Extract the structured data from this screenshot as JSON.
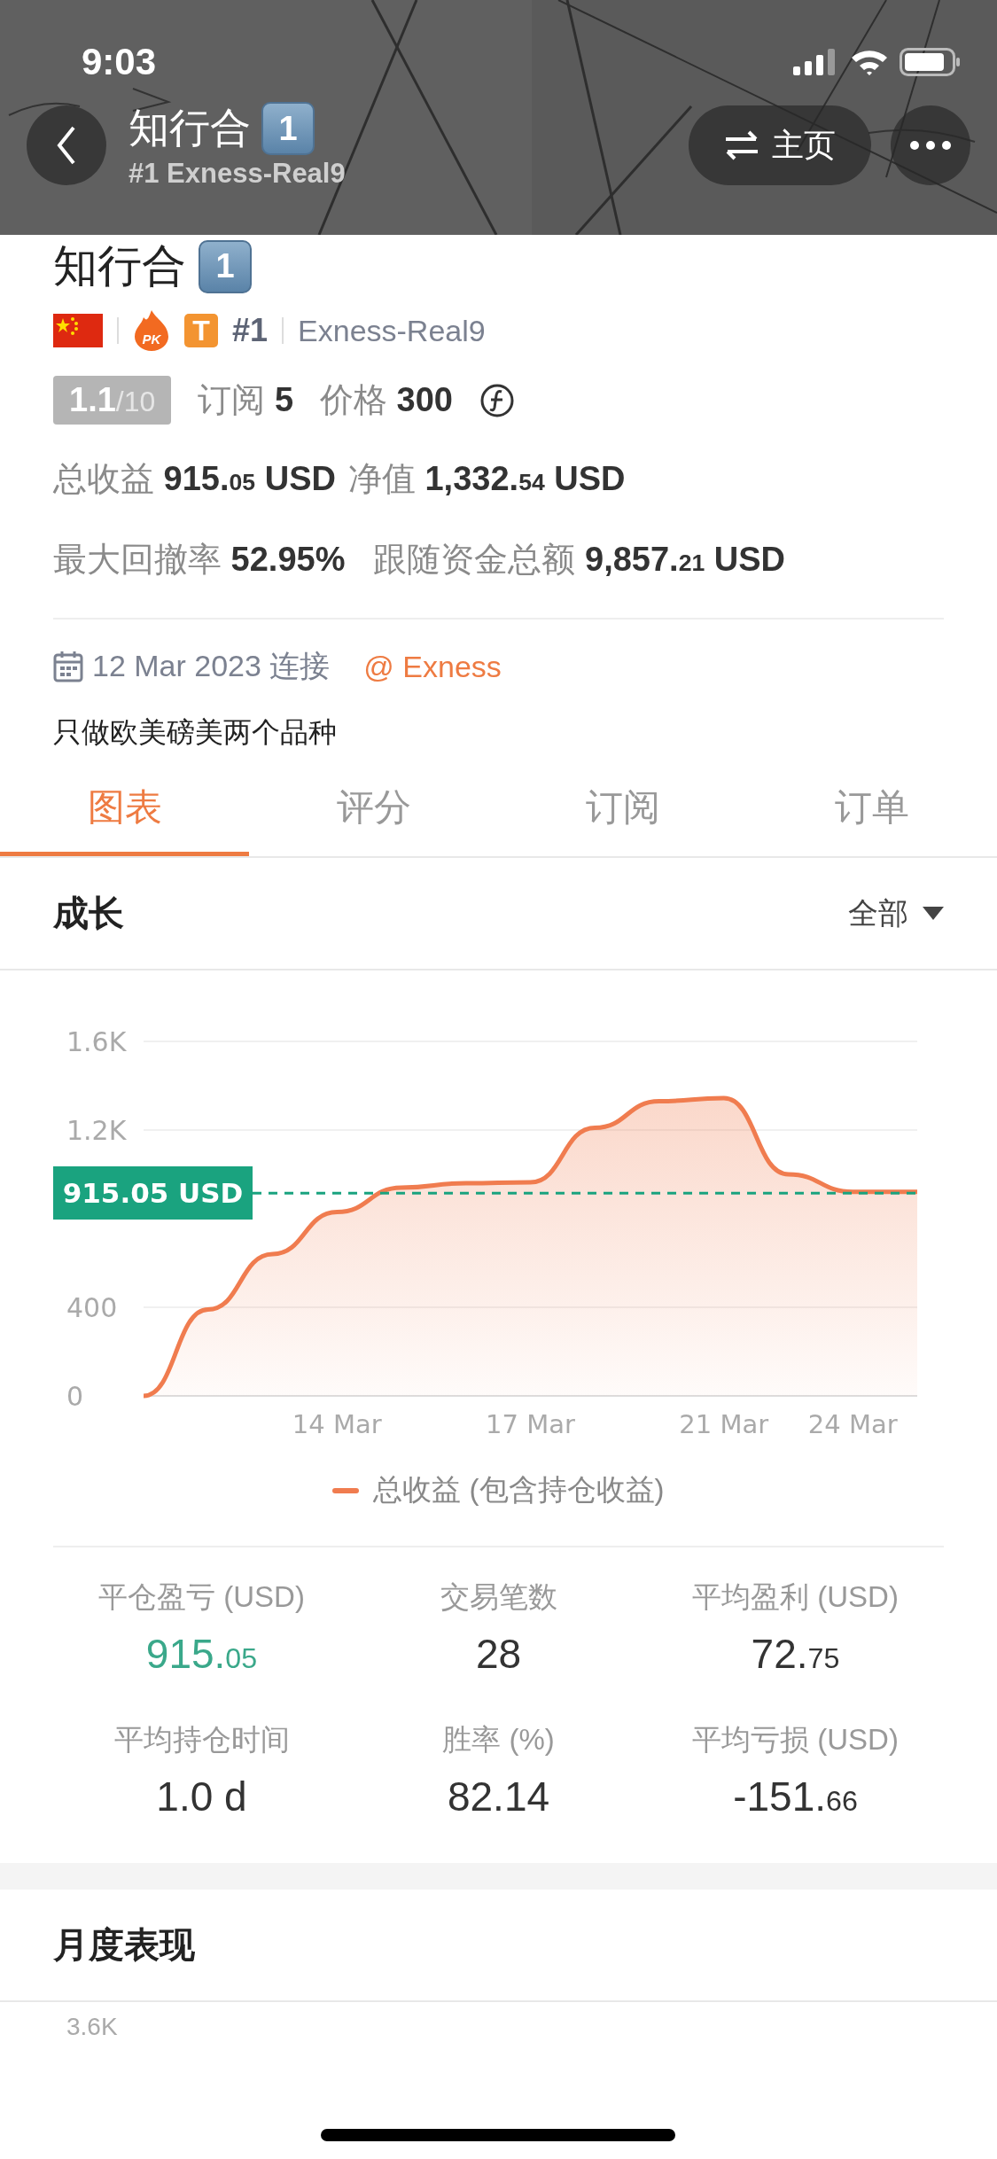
{
  "status_bar": {
    "time": "9:03"
  },
  "nav": {
    "title": "知行合",
    "title_badge": "1",
    "subtitle": "#1 Exness-Real9",
    "home_button": "主页"
  },
  "profile": {
    "name": "知行合",
    "name_badge": "1",
    "pk_badge": "PK",
    "t_badge": "T",
    "rank": "#1",
    "server": "Exness-Real9"
  },
  "rating": {
    "score": "1.1",
    "max": "/10"
  },
  "subscribe": {
    "label": "订阅",
    "value": "5"
  },
  "price": {
    "label": "价格",
    "value": "300"
  },
  "metrics": [
    {
      "label": "总收益",
      "int": "915.",
      "dec": "05",
      "unit": " USD"
    },
    {
      "label": "净值",
      "int": "1,332.",
      "dec": "54",
      "unit": " USD"
    },
    {
      "label": "最大回撤率",
      "int": "52.95%"
    },
    {
      "label": "跟随资金总额",
      "int": "9,857.",
      "dec": "21",
      "unit": " USD"
    }
  ],
  "connected": {
    "date": "12 Mar 2023 连接",
    "broker": "@ Exness"
  },
  "description": "只做欧美磅美两个品种",
  "tabs": [
    {
      "label": "图表",
      "selected": true
    },
    {
      "label": "评分",
      "selected": false
    },
    {
      "label": "订阅",
      "selected": false
    },
    {
      "label": "订单",
      "selected": false
    }
  ],
  "growth": {
    "title": "成长",
    "filter": "全部",
    "chart_data": {
      "type": "area",
      "categories": [
        null,
        null,
        null,
        "14 Mar",
        null,
        null,
        "17 Mar",
        null,
        null,
        "21 Mar",
        null,
        "24 Mar",
        null
      ],
      "ylim": [
        0,
        1600
      ],
      "yticks": [
        {
          "value": 0,
          "label": "0"
        },
        {
          "value": 400,
          "label": "400"
        },
        {
          "value": 1200,
          "label": "1.2K"
        },
        {
          "value": 1600,
          "label": "1.6K"
        }
      ],
      "series": [
        {
          "name": "总收益 (包含持仓收益)",
          "color": "#f07c4f",
          "values": [
            0,
            390,
            640,
            830,
            940,
            960,
            964,
            1210,
            1330,
            1344,
            1000,
            921,
            921
          ]
        }
      ],
      "ref_lines": [
        {
          "axis": "y",
          "value": 915.05,
          "label": "915.05 USD",
          "color": "#1aa37f"
        }
      ]
    }
  },
  "stats": [
    {
      "label": "平仓盈亏 (USD)",
      "int": "915.",
      "dec": "05",
      "color": "#3aa88a"
    },
    {
      "label": "交易笔数",
      "int": "28",
      "color": "#333333"
    },
    {
      "label": "平均盈利 (USD)",
      "int": "72.",
      "dec": "75",
      "color": "#333333"
    },
    {
      "label": "平均持仓时间",
      "int": "1.0 d",
      "color": "#333333"
    },
    {
      "label": "胜率 (%)",
      "int": "82.14",
      "color": "#333333"
    },
    {
      "label": "平均亏损 (USD)",
      "int": "-151.",
      "dec": "66",
      "color": "#333333"
    }
  ],
  "monthly": {
    "title": "月度表现",
    "first_tick": "3.6K"
  }
}
